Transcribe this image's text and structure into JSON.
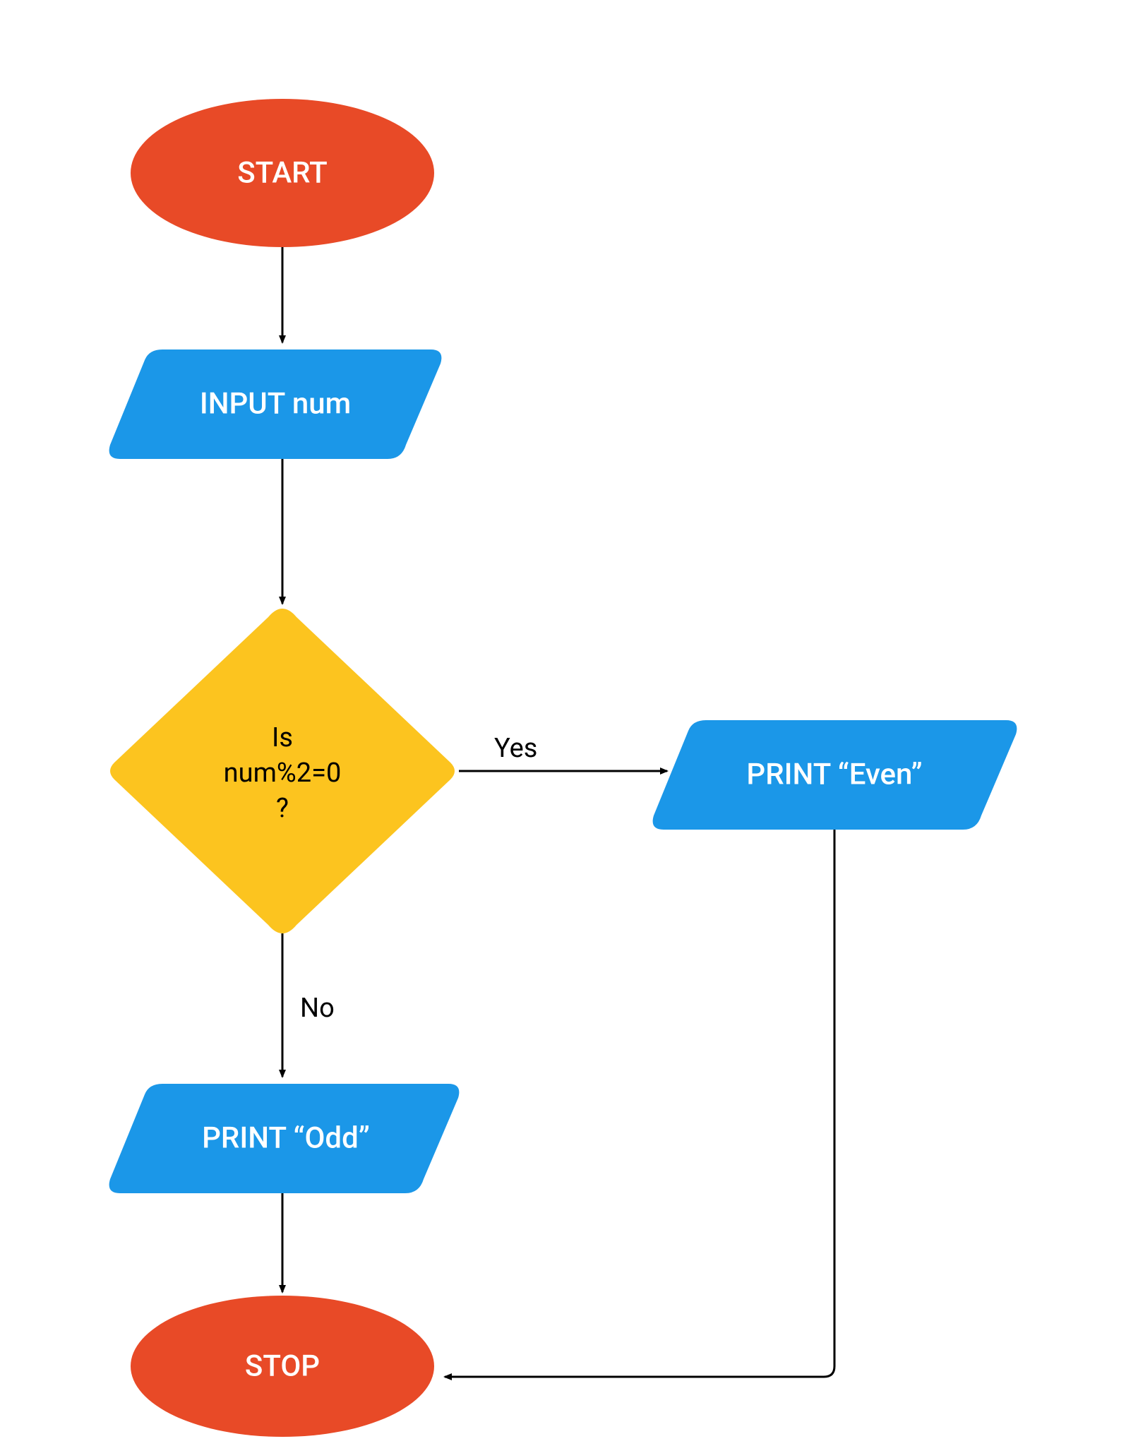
{
  "flowchart": {
    "nodes": {
      "start": {
        "type": "terminal",
        "label": "START"
      },
      "input": {
        "type": "io",
        "label": "INPUT num"
      },
      "decision": {
        "type": "decision",
        "line1": "Is",
        "line2": "num%2=0",
        "line3": "?"
      },
      "print_even": {
        "type": "io",
        "label": "PRINT “Even”"
      },
      "print_odd": {
        "type": "io",
        "label": "PRINT “Odd”"
      },
      "stop": {
        "type": "terminal",
        "label": "STOP"
      }
    },
    "edges": {
      "yes": {
        "label": "Yes"
      },
      "no": {
        "label": "No"
      }
    },
    "colors": {
      "terminal": "#E84A27",
      "io": "#1B97E8",
      "decision": "#FCC41F",
      "line": "#000000"
    }
  }
}
